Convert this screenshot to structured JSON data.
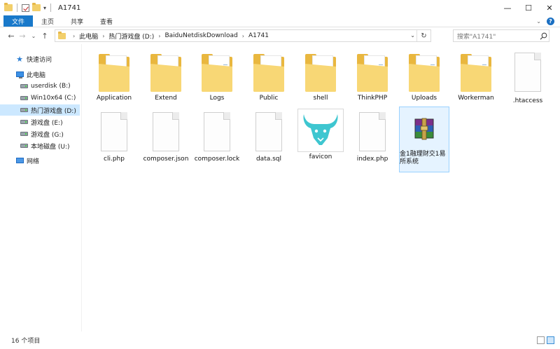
{
  "window": {
    "title": "A1741",
    "controls": {
      "minimize": "—",
      "maximize": "☐",
      "close": "✕"
    }
  },
  "ribbon": {
    "tabs": [
      {
        "label": "文件",
        "active": true
      },
      {
        "label": "主页"
      },
      {
        "label": "共享"
      },
      {
        "label": "查看"
      }
    ],
    "expand_glyph": "⌄"
  },
  "nav": {
    "back": "←",
    "forward": "→",
    "recent": "⌄",
    "up": "↑"
  },
  "address": {
    "crumbs": [
      "此电脑",
      "热门游戏盘 (D:)",
      "BaiduNetdiskDownload",
      "A1741"
    ]
  },
  "search": {
    "placeholder": "搜索\"A1741\""
  },
  "sidebar": {
    "items": [
      {
        "label": "快速访问",
        "icon": "quick-access-star-icon",
        "indent": 0
      },
      {
        "label": "此电脑",
        "icon": "this-pc-icon",
        "indent": 0
      },
      {
        "label": "userdisk (B:)",
        "icon": "drive-icon",
        "indent": 1
      },
      {
        "label": "Win10x64 (C:)",
        "icon": "drive-icon",
        "indent": 1
      },
      {
        "label": "热门游戏盘 (D:)",
        "icon": "drive-icon",
        "indent": 1,
        "selected": true
      },
      {
        "label": "游戏盘 (E:)",
        "icon": "drive-icon",
        "indent": 1
      },
      {
        "label": "游戏盘 (G:)",
        "icon": "drive-icon",
        "indent": 1
      },
      {
        "label": "本地磁盘 (U:)",
        "icon": "drive-icon",
        "indent": 1
      },
      {
        "label": "网络",
        "icon": "network-icon",
        "indent": 0
      }
    ]
  },
  "files": [
    {
      "name": "Application",
      "type": "folder"
    },
    {
      "name": "Extend",
      "type": "folder"
    },
    {
      "name": "Logs",
      "type": "folder"
    },
    {
      "name": "Public",
      "type": "folder"
    },
    {
      "name": "shell",
      "type": "folder"
    },
    {
      "name": "ThinkPHP",
      "type": "folder"
    },
    {
      "name": "Uploads",
      "type": "folder"
    },
    {
      "name": "Workerman",
      "type": "folder"
    },
    {
      "name": ".htaccess",
      "type": "file"
    },
    {
      "name": "cli.php",
      "type": "file"
    },
    {
      "name": "composer.json",
      "type": "file"
    },
    {
      "name": "composer.lock",
      "type": "file"
    },
    {
      "name": "data.sql",
      "type": "file"
    },
    {
      "name": "favicon",
      "type": "image"
    },
    {
      "name": "index.php",
      "type": "file"
    },
    {
      "name": "金1融理财交1易所系统",
      "type": "rar",
      "selected": true
    }
  ],
  "status": {
    "count_text": "16 个项目"
  },
  "colors": {
    "accent": "#1979ca",
    "selection": "#cce8ff",
    "folder": "#f8d775",
    "favicon_teal": "#3ec6d0"
  }
}
